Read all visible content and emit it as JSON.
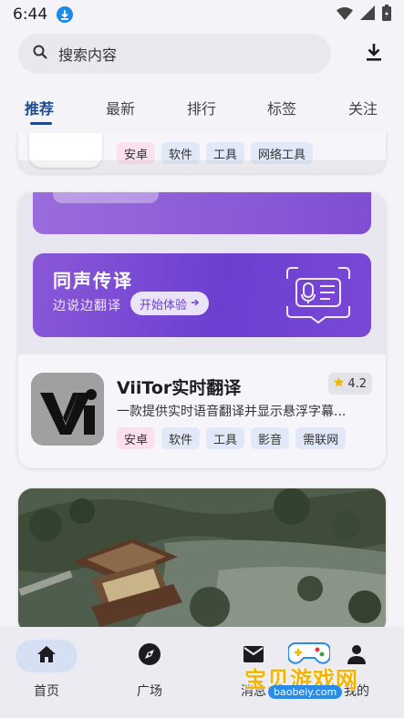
{
  "status_bar": {
    "time": "6:44"
  },
  "search": {
    "placeholder": "搜索内容"
  },
  "tabs": [
    {
      "label": "推荐",
      "active": true
    },
    {
      "label": "最新"
    },
    {
      "label": "排行"
    },
    {
      "label": "标签"
    },
    {
      "label": "关注"
    }
  ],
  "feed": {
    "card1": {
      "tags": [
        "安卓",
        "软件",
        "工具",
        "网络工具"
      ]
    },
    "card2": {
      "banner": {
        "title": "同声传译",
        "subtitle": "边说边翻译",
        "button": "开始体验"
      },
      "app": {
        "title": "ViiTor实时翻译",
        "rating": "4.2",
        "description": "一款提供实时语音翻译并显示悬浮字幕...",
        "tags": [
          "安卓",
          "软件",
          "工具",
          "影音",
          "需联网"
        ]
      }
    }
  },
  "bottom_nav": [
    {
      "label": "首页",
      "icon": "home-icon",
      "active": true
    },
    {
      "label": "广场",
      "icon": "compass-icon"
    },
    {
      "label": "消息",
      "icon": "mail-icon"
    },
    {
      "label": "我的",
      "icon": "person-icon"
    }
  ],
  "watermark": {
    "text": "宝贝游戏网",
    "url": "baobeiy.com"
  },
  "colors": {
    "accent": "#1d4a8a",
    "banner_purple": "#6c3fd0",
    "star": "#f2b705"
  }
}
